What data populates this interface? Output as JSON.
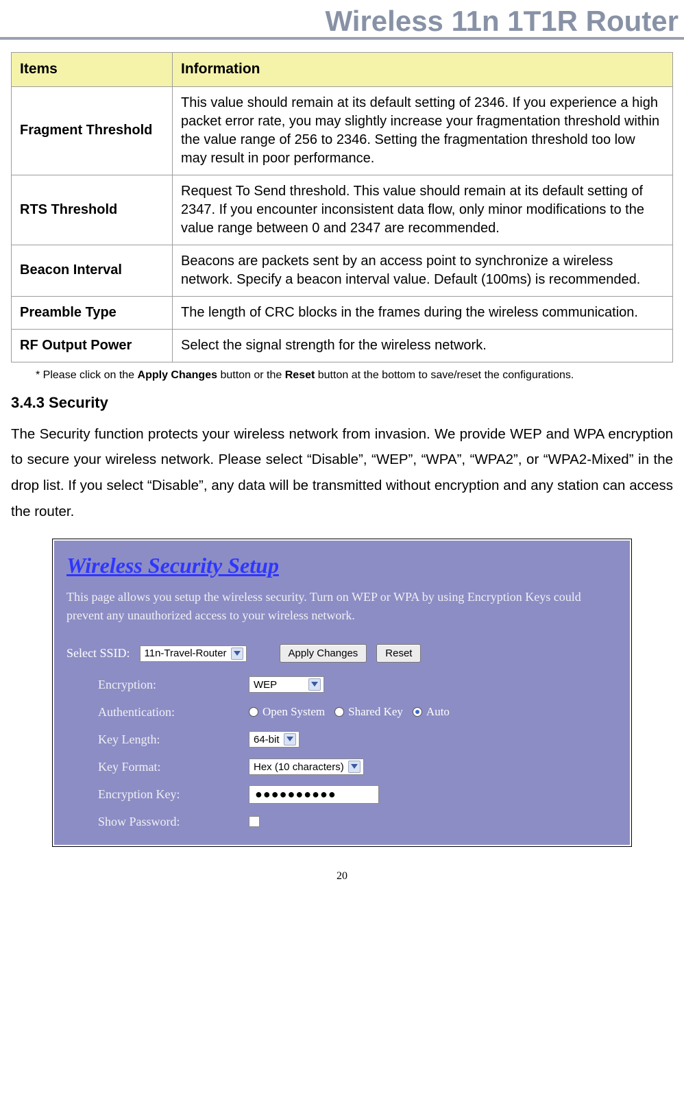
{
  "header": {
    "title": "Wireless 11n 1T1R Router"
  },
  "table": {
    "headers": {
      "items": "Items",
      "info": "Information"
    },
    "rows": [
      {
        "item": "Fragment Threshold",
        "info": "This value should remain at its default setting of 2346. If you experience a high packet error rate, you may slightly increase your fragmentation threshold within the value range of 256 to 2346. Setting the fragmentation threshold too low may result in poor performance."
      },
      {
        "item": "RTS Threshold",
        "info": "Request To Send threshold. This value should remain at its default setting of 2347. If you encounter inconsistent data flow, only minor modifications to the value range between 0 and 2347 are recommended."
      },
      {
        "item": "Beacon Interval",
        "info": "Beacons are packets sent by an access point to synchronize a wireless network. Specify a beacon interval value. Default (100ms) is recommended."
      },
      {
        "item": "Preamble Type",
        "info": "The length of CRC blocks in the frames during the wireless communication."
      },
      {
        "item": "RF Output Power",
        "info": "Select the signal strength for the wireless network."
      }
    ]
  },
  "footnote": {
    "prefix": "* Please click on the ",
    "bold1": "Apply Changes",
    "mid": " button or the ",
    "bold2": "Reset",
    "suffix": " button at the bottom to save/reset the configurations."
  },
  "section": {
    "heading": "3.4.3 Security",
    "body": "The Security function protects your wireless network from invasion. We provide WEP and WPA encryption to secure your wireless network. Please select “Disable”, “WEP”, “WPA”, “WPA2”, or “WPA2-Mixed” in the drop list. If you select “Disable”, any data will be transmitted without encryption and any station can access the router."
  },
  "panel": {
    "heading": "Wireless Security Setup",
    "desc": "This page allows you setup the wireless security. Turn on WEP or WPA by using Encryption Keys could prevent any unauthorized access to your wireless network.",
    "ssid_label": "Select SSID:",
    "ssid_value": "11n-Travel-Router",
    "apply_label": "Apply Changes",
    "reset_label": "Reset",
    "rows": {
      "encryption": {
        "label": "Encryption:",
        "value": "WEP"
      },
      "authentication": {
        "label": "Authentication:",
        "options": {
          "open": "Open System",
          "shared": "Shared Key",
          "auto": "Auto"
        }
      },
      "key_length": {
        "label": "Key Length:",
        "value": "64-bit"
      },
      "key_format": {
        "label": "Key Format:",
        "value": "Hex (10 characters)"
      },
      "encryption_key": {
        "label": "Encryption Key:",
        "value": "●●●●●●●●●●"
      },
      "show_password": {
        "label": "Show Password:"
      }
    }
  },
  "page_number": "20"
}
